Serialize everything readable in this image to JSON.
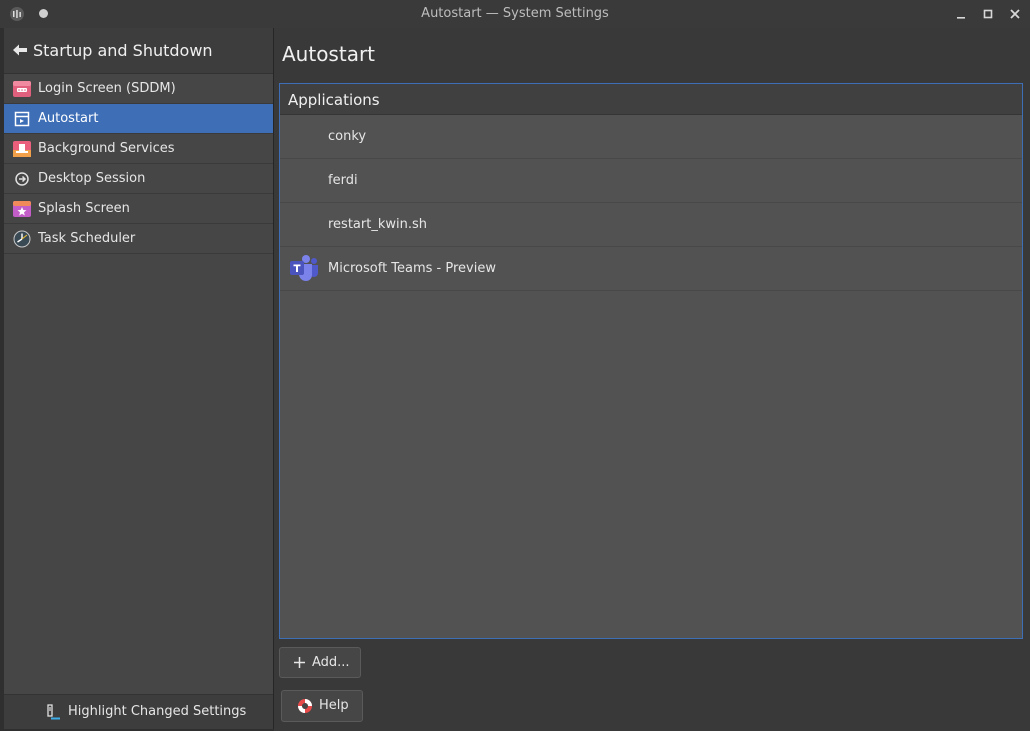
{
  "window": {
    "title": "Autostart — System Settings"
  },
  "sidebar": {
    "header": "Startup and Shutdown",
    "items": [
      {
        "label": "Login Screen (SDDM)",
        "icon": "login-screen-icon"
      },
      {
        "label": "Autostart",
        "icon": "autostart-icon",
        "active": true
      },
      {
        "label": "Background Services",
        "icon": "background-services-icon"
      },
      {
        "label": "Desktop Session",
        "icon": "desktop-session-icon"
      },
      {
        "label": "Splash Screen",
        "icon": "splash-screen-icon"
      },
      {
        "label": "Task Scheduler",
        "icon": "task-scheduler-icon"
      }
    ],
    "footer": "Highlight Changed Settings"
  },
  "main": {
    "title": "Autostart",
    "section": "Applications",
    "apps": [
      {
        "name": "conky",
        "icon": ""
      },
      {
        "name": "ferdi",
        "icon": ""
      },
      {
        "name": "restart_kwin.sh",
        "icon": ""
      },
      {
        "name": "Microsoft Teams - Preview",
        "icon": "teams-icon"
      }
    ],
    "add_label": "Add...",
    "help_label": "Help"
  },
  "colors": {
    "accent": "#3d6eb6",
    "background": "#393939",
    "sidebar": "#464646"
  }
}
